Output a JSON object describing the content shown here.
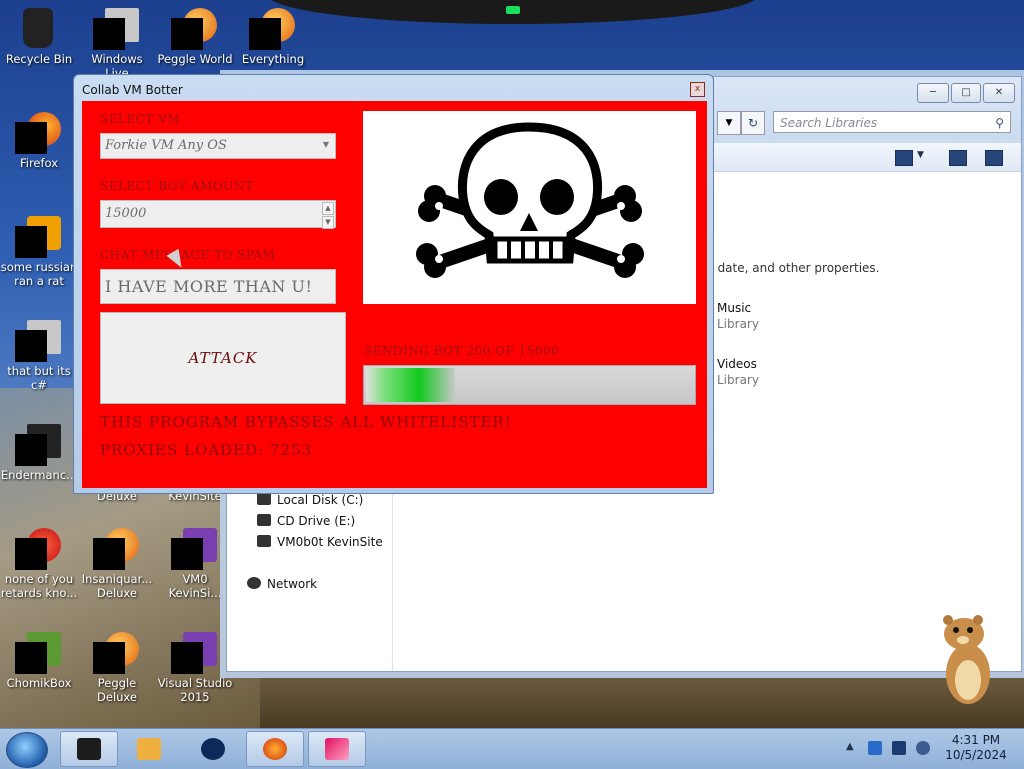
{
  "desktop": {
    "icons": [
      {
        "label": "Recycle Bin"
      },
      {
        "label": "Windows Live"
      },
      {
        "label": "Peggle World"
      },
      {
        "label": "Everything"
      },
      {
        "label": "Firefox"
      },
      {
        "label": "some russian ran a rat"
      },
      {
        "label": "that but its c#"
      },
      {
        "label": "Endermanc..."
      },
      {
        "label": "Deluxe"
      },
      {
        "label": "KevinSite"
      },
      {
        "label": "none of you retards kno..."
      },
      {
        "label": "Insaniquar... Deluxe"
      },
      {
        "label": "VM0 KevinSi..."
      },
      {
        "label": "ChomikBox"
      },
      {
        "label": "Peggle Deluxe"
      },
      {
        "label": "Visual Studio 2015"
      }
    ]
  },
  "explorer": {
    "search_placeholder": "Search Libraries",
    "description": "r, date, and other properties.",
    "libraries": [
      {
        "name": "Music",
        "type": "Library"
      },
      {
        "name": "Videos",
        "type": "Library"
      }
    ],
    "nav": [
      "Local Disk (C:)",
      "CD Drive (E:)",
      "VM0b0t KevinSite",
      "Network"
    ]
  },
  "botwindow": {
    "title": "Collab VM Botter",
    "close_label": "x",
    "select_vm_label": "SELECT VM",
    "select_vm_value": "Forkie VM Any OS",
    "bot_amount_label": "SELECT BOT AMOUNT",
    "bot_amount_value": "15000",
    "chat_label": "CHAT MESSAGE TO SPAM",
    "chat_value": "I HAVE MORE THAN U!",
    "attack_label": "ATTACK",
    "status_text": "SENDING BOT 200 OF 15000",
    "progress_fraction": 0.27,
    "bypass_text": "THIS PROGRAM BYPASSES ALL WHITELISTER!",
    "proxies_text": "PROXIES LOADED: 7253",
    "body_color": "#ff0000"
  },
  "taskbar": {
    "time": "4:31 PM",
    "date": "10/5/2024"
  }
}
